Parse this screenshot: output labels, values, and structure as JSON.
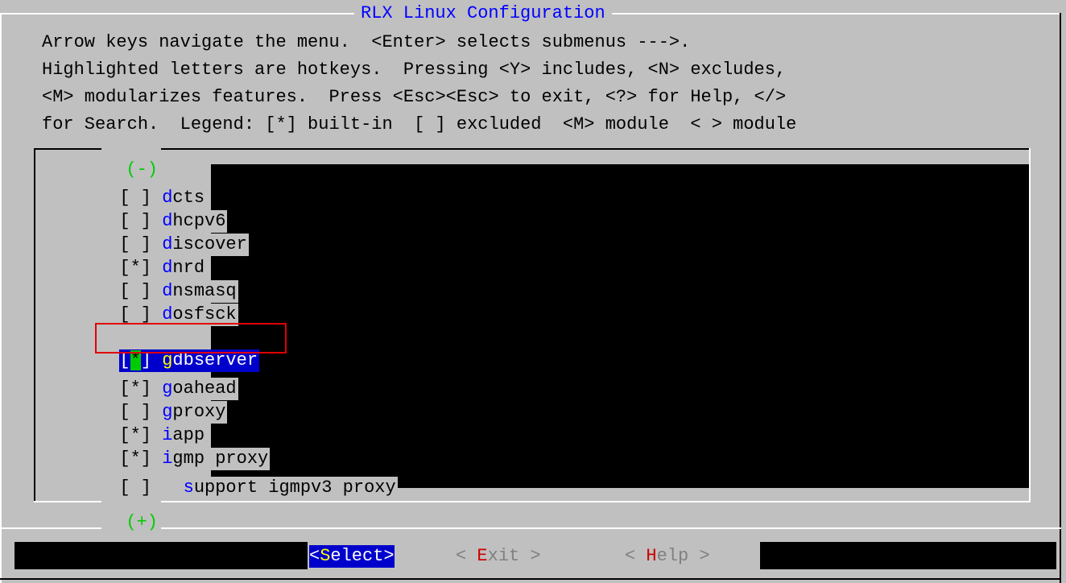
{
  "dialog": {
    "title": "RLX Linux Configuration",
    "help_lines": [
      "Arrow keys navigate the menu.  <Enter> selects submenus --->.",
      "Highlighted letters are hotkeys.  Pressing <Y> includes, <N> excludes,",
      "<M> modularizes features.  Press <Esc><Esc> to exit, <?> for Help, </>",
      "for Search.  Legend: [*] built-in  [ ] excluded  <M> module  < > module"
    ]
  },
  "scroll": {
    "top_marker": "(-)",
    "bottom_marker": "(+)"
  },
  "items": [
    {
      "check": "[ ]",
      "hotkey": "d",
      "rest": "cts"
    },
    {
      "check": "[ ]",
      "hotkey": "d",
      "rest": "hcpv6"
    },
    {
      "check": "[ ]",
      "hotkey": "d",
      "rest": "iscover"
    },
    {
      "check": "[*]",
      "hotkey": "d",
      "rest": "nrd"
    },
    {
      "check": "[ ]",
      "hotkey": "d",
      "rest": "nsmasq"
    },
    {
      "check": "[ ]",
      "hotkey": "d",
      "rest": "osfsck"
    },
    {
      "check_open": "[",
      "check_mark": "*",
      "check_close": "]",
      "hotkey": "g",
      "rest": "dbserver",
      "selected": true
    },
    {
      "check": "[*]",
      "hotkey": "g",
      "rest": "oahead"
    },
    {
      "check": "[ ]",
      "hotkey": "g",
      "rest": "proxy"
    },
    {
      "check": "[*]",
      "hotkey": "i",
      "rest": "app"
    },
    {
      "check": "[*]",
      "hotkey": "i",
      "rest": "gmp proxy"
    },
    {
      "check": "[ ]",
      "indent": "  ",
      "hotkey": "s",
      "rest": "upport igmpv3 proxy"
    }
  ],
  "buttons": {
    "select": {
      "open": "<",
      "hotkey": "S",
      "rest": "elect",
      "close": ">"
    },
    "exit": {
      "open": "< ",
      "hotkey": "E",
      "rest": "xit",
      "close": " >"
    },
    "help": {
      "open": "< ",
      "hotkey": "H",
      "rest": "elp",
      "close": " >"
    }
  },
  "colors": {
    "background": "#c0c0c0",
    "hotkey": "#0000ff",
    "selected_bg": "#0000cc",
    "selected_hotkey": "#ffff00",
    "marker_green": "#00cc00",
    "disabled_hotkey": "#cc0000"
  }
}
